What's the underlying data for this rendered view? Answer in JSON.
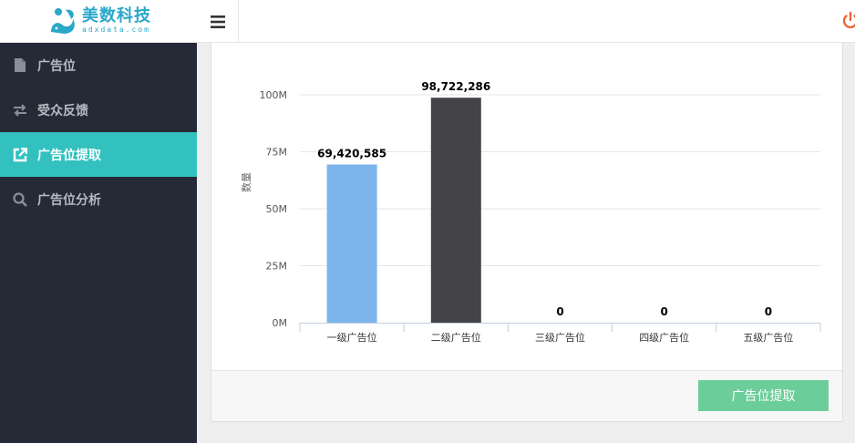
{
  "brand": {
    "name_cn": "美数科技",
    "name_en": "adxdata.com"
  },
  "header": {
    "menu_icon": "bars-icon",
    "logout_icon": "power-icon"
  },
  "sidebar": {
    "items": [
      {
        "label": "广告位",
        "icon": "file-icon",
        "active": false
      },
      {
        "label": "受众反馈",
        "icon": "exchange-icon",
        "active": false
      },
      {
        "label": "广告位提取",
        "icon": "external-link-icon",
        "active": true
      },
      {
        "label": "广告位分析",
        "icon": "search-icon",
        "active": false
      }
    ]
  },
  "main": {
    "extract_button": "广告位提取"
  },
  "colors": {
    "sidebar": "#262a37",
    "active": "#32c1bf",
    "button": "#6bce9a",
    "bar1": "#7cb5ec",
    "bar2": "#434348"
  },
  "chart_data": {
    "type": "bar",
    "categories": [
      "一级广告位",
      "二级广告位",
      "三级广告位",
      "四级广告位",
      "五级广告位"
    ],
    "values": [
      69420585,
      98722286,
      0,
      0,
      0
    ],
    "value_labels": [
      "69,420,585",
      "98,722,286",
      "0",
      "0",
      "0"
    ],
    "bar_colors": [
      "#7cb5ec",
      "#434348",
      "#90ed7d",
      "#f7a35c",
      "#8085e9"
    ],
    "ylabel": "数量",
    "ylim": [
      0,
      100000000
    ],
    "yticks": [
      "0M",
      "25M",
      "50M",
      "75M",
      "100M"
    ],
    "grid": true,
    "legend": "none"
  }
}
